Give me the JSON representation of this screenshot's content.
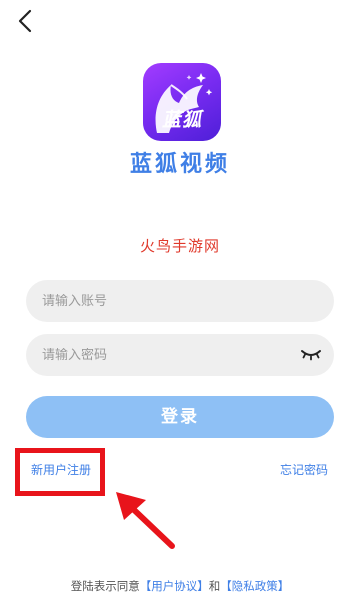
{
  "header": {
    "back_icon": "chevron-left-icon"
  },
  "brand": {
    "logo_text": "蓝狐",
    "app_name": "蓝狐视频",
    "logo_colors": [
      "#a33cff",
      "#4e1fd8"
    ]
  },
  "watermark": "火鸟手游网",
  "form": {
    "account_placeholder": "请输入账号",
    "account_value": "",
    "password_placeholder": "请输入密码",
    "password_value": "",
    "password_toggle_icon": "eye-closed-icon",
    "login_label": "登录"
  },
  "links": {
    "register": "新用户注册",
    "forgot_password": "忘记密码"
  },
  "agreement": {
    "prefix": "登陆表示同意",
    "user_agreement": "【用户协议】",
    "and": "和",
    "privacy_policy": "【隐私政策】"
  },
  "annotation": {
    "highlight_color": "#e8141b",
    "arrow_icon": "arrow-up-left-icon"
  },
  "colors": {
    "accent": "#3f7fe6",
    "login_button": "#8ec0f5",
    "field_bg": "#efefef"
  }
}
